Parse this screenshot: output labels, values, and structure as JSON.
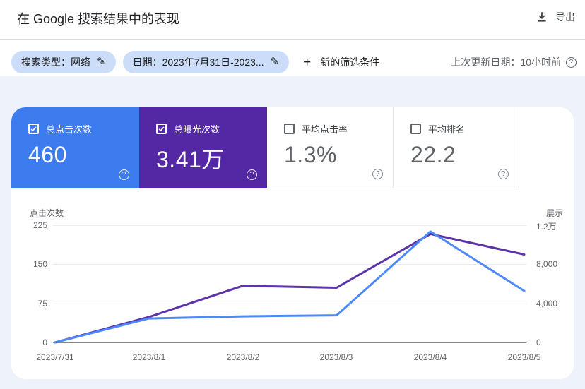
{
  "header": {
    "title": "在 Google 搜索结果中的表现",
    "export_label": "导出"
  },
  "filters": {
    "search_type_chip": "搜索类型：网络",
    "date_chip": "日期：2023年7月31日-2023...",
    "add_filter_label": "新的筛选条件",
    "plus": "+",
    "last_updated": "上次更新日期：10小时前"
  },
  "cards": [
    {
      "label": "总点击次数",
      "value": "460",
      "checked": true,
      "color": "#3d7cee"
    },
    {
      "label": "总曝光次数",
      "value": "3.41万",
      "checked": true,
      "color": "#5428a5"
    },
    {
      "label": "平均点击率",
      "value": "1.3%",
      "checked": false,
      "color": "#ffffff"
    },
    {
      "label": "平均排名",
      "value": "22.2",
      "checked": false,
      "color": "#ffffff"
    }
  ],
  "help_glyph": "?",
  "chart_data": {
    "type": "line",
    "x": [
      "2023/7/31",
      "2023/8/1",
      "2023/8/2",
      "2023/8/3",
      "2023/8/4",
      "2023/8/5"
    ],
    "series": [
      {
        "name": "点击次数",
        "axis": "left",
        "color": "#4e8af7",
        "values": [
          0,
          46,
          50,
          52,
          213,
          99
        ]
      },
      {
        "name": "展示",
        "axis": "right",
        "color": "#5c33ab",
        "values": [
          0,
          2600,
          5800,
          5600,
          11100,
          9000
        ]
      }
    ],
    "left_axis": {
      "label": "点击次数",
      "max": 225,
      "min": 0,
      "ticks": [
        "225",
        "150",
        "75",
        "0"
      ]
    },
    "right_axis": {
      "label": "展示",
      "max": 12000,
      "min": 0,
      "ticks": [
        "1.2万",
        "8,000",
        "4,000",
        "0"
      ]
    },
    "grid": "horizontal",
    "legend_position": "none"
  },
  "colors": {
    "content_background": "#eef2fa",
    "header_background": "#ffffff",
    "chip_background": "#cbddf8",
    "clicks_card": "#3d7cee",
    "impressions_card": "#5428a5",
    "clicks_line": "#4e8af7",
    "impressions_line": "#5c33ab",
    "gridline": "#e9ecef",
    "zero_line": "#80868b",
    "muted_text": "#5f6368"
  }
}
